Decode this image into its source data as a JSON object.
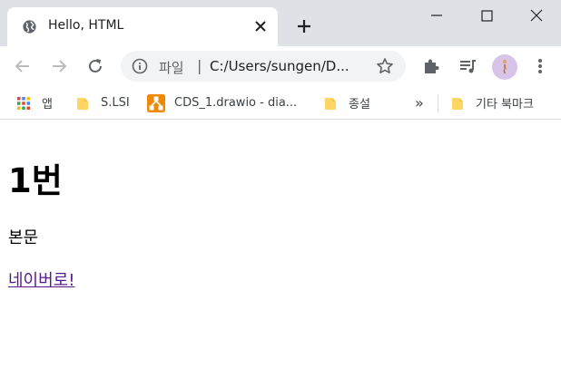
{
  "tab": {
    "title": "Hello, HTML",
    "favicon": "globe-icon"
  },
  "toolbar": {
    "url_prefix": "파일",
    "url_separator": "|",
    "url": "C:/Users/sungen/D..."
  },
  "bookmarks": {
    "items": [
      {
        "label": "앱",
        "icon": "apps-grid-icon"
      },
      {
        "label": "S.LSI",
        "icon": "folder-icon"
      },
      {
        "label": "CDS_1.drawio - dia...",
        "icon": "drawio-icon"
      },
      {
        "label": "종설",
        "icon": "folder-icon"
      }
    ],
    "overflow": "»",
    "other": {
      "label": "기타 북마크",
      "icon": "folder-icon"
    }
  },
  "page": {
    "heading": "1번",
    "paragraph": "본문",
    "link": "네이버로!"
  },
  "colors": {
    "tabstrip_bg": "#dee1e6",
    "omnibox_bg": "#f1f3f4",
    "visited_link": "#551a8b",
    "folder_yellow": "#fdd663",
    "drawio_orange": "#f08705"
  }
}
